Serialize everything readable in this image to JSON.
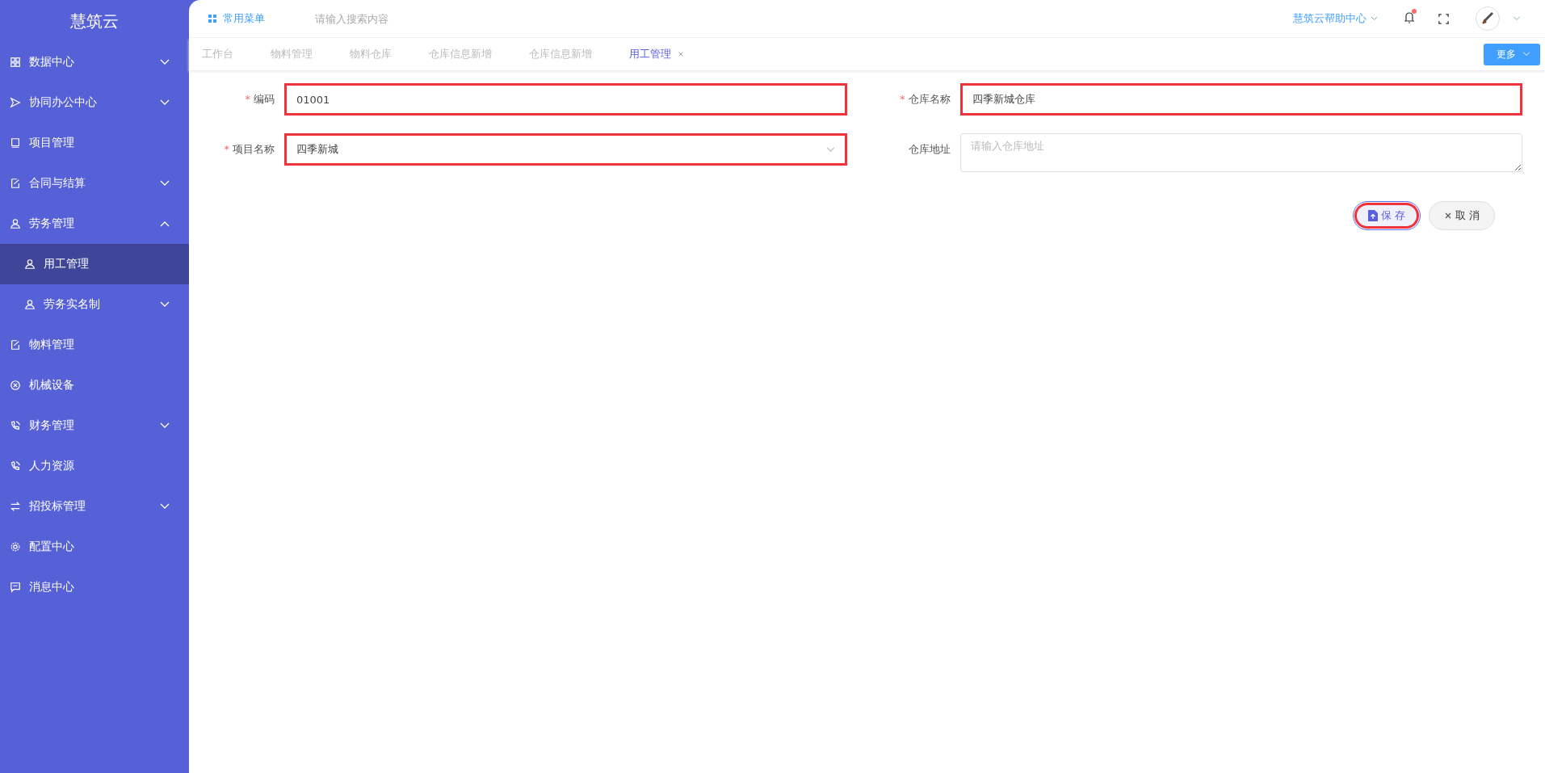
{
  "sidebar": {
    "title": "慧筑云",
    "items": [
      {
        "label": "数据中心",
        "selected": false,
        "expanded": false
      },
      {
        "label": "协同办公中心",
        "selected": false,
        "expanded": false
      },
      {
        "label": "项目管理",
        "selected": false
      },
      {
        "label": "合同与结算",
        "selected": false,
        "expanded": false
      },
      {
        "label": "劳务管理",
        "selected": false,
        "expanded": true,
        "children": [
          {
            "label": "用工管理",
            "selected": true
          },
          {
            "label": "劳务实名制",
            "selected": false,
            "expanded": false
          }
        ]
      },
      {
        "label": "物料管理",
        "selected": false
      },
      {
        "label": "机械设备",
        "selected": false
      },
      {
        "label": "财务管理",
        "selected": false,
        "expanded": false
      },
      {
        "label": "人力资源",
        "selected": false
      },
      {
        "label": "招投标管理",
        "selected": false,
        "expanded": false
      },
      {
        "label": "配置中心",
        "selected": false
      },
      {
        "label": "消息中心",
        "selected": false
      }
    ]
  },
  "topbar": {
    "menu": "常用菜单",
    "search": {
      "placeholder": "请输入搜索内容"
    },
    "help": "慧筑云帮助中心",
    "notification_dot": true
  },
  "tabs": [
    {
      "label": "工作台",
      "selected": false
    },
    {
      "label": "物料管理",
      "selected": false
    },
    {
      "label": "物料仓库",
      "selected": false
    },
    {
      "label": "仓库信息新增",
      "selected": false
    },
    {
      "label": "仓库信息新增",
      "selected": false
    },
    {
      "label": "用工管理",
      "selected": true,
      "closable": true
    }
  ],
  "more_button": "更多",
  "form": {
    "fields": [
      {
        "label": "编码",
        "required_mark": "*",
        "kind": "input",
        "value": "01001",
        "highlighted": true
      },
      {
        "label": "仓库名称",
        "required_mark": "*",
        "kind": "input",
        "value": "四季新城仓库",
        "highlighted": true
      },
      {
        "label": "项目名称",
        "required_mark": "*",
        "kind": "select",
        "value": "四季新城",
        "highlighted": true
      },
      {
        "label": "仓库地址",
        "kind": "textarea",
        "placeholder": "请输入仓库地址",
        "highlighted": false
      }
    ],
    "buttons": [
      {
        "label": "保 存",
        "kind": "save",
        "highlighted": true
      },
      {
        "label": "取 消",
        "kind": "cancel",
        "highlighted": false
      }
    ]
  }
}
